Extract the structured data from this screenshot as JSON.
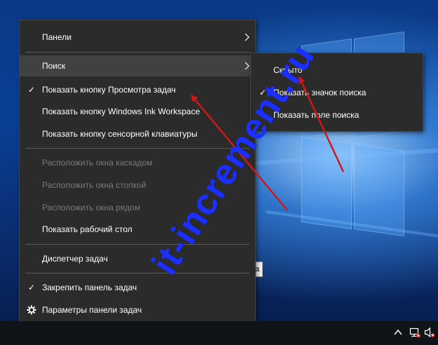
{
  "context_menu": {
    "items": [
      {
        "label": "Панели",
        "checked": false,
        "disabled": false,
        "submenu": true
      },
      {
        "label": "Поиск",
        "checked": false,
        "disabled": false,
        "submenu": true,
        "highlighted": true
      },
      {
        "label": "Показать кнопку Просмотра задач",
        "checked": true,
        "disabled": false
      },
      {
        "label": "Показать кнопку Windows Ink Workspace",
        "checked": false,
        "disabled": false
      },
      {
        "label": "Показать кнопку сенсорной клавиатуры",
        "checked": false,
        "disabled": false
      },
      {
        "label": "Расположить окна каскадом",
        "checked": false,
        "disabled": true
      },
      {
        "label": "Расположить окна стопкой",
        "checked": false,
        "disabled": true
      },
      {
        "label": "Расположить окна рядом",
        "checked": false,
        "disabled": true
      },
      {
        "label": "Показать рабочий стол",
        "checked": false,
        "disabled": false
      },
      {
        "label": "Диспетчер задач",
        "checked": false,
        "disabled": false
      },
      {
        "label": "Закрепить панель задач",
        "checked": true,
        "disabled": false
      },
      {
        "label": "Параметры панели задач",
        "checked": false,
        "disabled": false,
        "icon": "gear-icon"
      }
    ]
  },
  "search_submenu": {
    "items": [
      {
        "label": "Скрыто",
        "checked": false
      },
      {
        "label": "Показать значок поиска",
        "checked": true
      },
      {
        "label": "Показать поле поиска",
        "checked": false
      }
    ]
  },
  "tooltip_fragment": "а",
  "watermark": "it-increment.ru",
  "glyphs": {
    "check": "✓"
  },
  "tray_icons": [
    "chevron-up-icon",
    "network-icon",
    "volume-muted-icon"
  ],
  "colors": {
    "menu_bg": "#2b2b2b",
    "menu_hover": "#414141",
    "disabled_text": "#7a7a7a",
    "annotation_arrow": "#d01818",
    "watermark": "#1b2fff"
  }
}
